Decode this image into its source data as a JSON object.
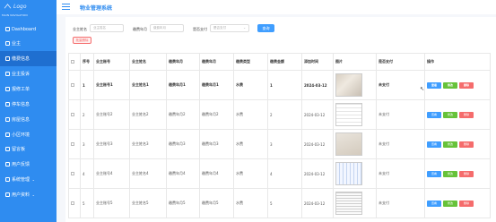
{
  "sidebar": {
    "logo_text": "Logo",
    "caption": "MAIN NAVIGATION",
    "items": [
      {
        "label": "Dashboard",
        "icon": "dashboard-icon"
      },
      {
        "label": "业主",
        "icon": "user-icon"
      },
      {
        "label": "缴费信息",
        "icon": "payment-icon",
        "active": true
      },
      {
        "label": "业主投诉",
        "icon": "complaint-icon"
      },
      {
        "label": "报修工单",
        "icon": "repair-icon"
      },
      {
        "label": "停车信息",
        "icon": "parking-icon"
      },
      {
        "label": "房屋信息",
        "icon": "house-icon"
      },
      {
        "label": "小区环境",
        "icon": "environment-icon"
      },
      {
        "label": "留言板",
        "icon": "message-icon"
      },
      {
        "label": "用户反馈",
        "icon": "feedback-icon"
      },
      {
        "label": "系统管理",
        "icon": "settings-icon",
        "expandable": true
      },
      {
        "label": "用户资料",
        "icon": "profile-icon",
        "expandable": true
      }
    ]
  },
  "header": {
    "title": "物业管理系统"
  },
  "filters": {
    "owner_name_label": "业主姓名",
    "owner_name_placeholder": "业主姓名",
    "fee_year_label": "缴费年月",
    "fee_year_placeholder": "缴费年月",
    "paid_label": "是否支付",
    "paid_placeholder": "是否支付",
    "search_button": "查询",
    "batch_delete_button": "批量删除"
  },
  "table": {
    "headers": [
      "",
      "序号",
      "业主账号",
      "业主姓名",
      "缴费年月",
      "缴费年月",
      "缴费类型",
      "缴费金额",
      "添加时间",
      "图片",
      "是否支付",
      "操作"
    ],
    "rows": [
      {
        "idx": "1",
        "account": "业主账号1",
        "name": "业主姓名1",
        "year": "缴费年月1",
        "month": "缴费年月1",
        "type": "水费",
        "amount": "1",
        "date": "2024-03-12",
        "paid": "未支付"
      },
      {
        "idx": "2",
        "account": "业主账号2",
        "name": "业主姓名2",
        "year": "缴费年月2",
        "month": "缴费年月2",
        "type": "水费",
        "amount": "2",
        "date": "2024-03-12",
        "paid": "未支付"
      },
      {
        "idx": "3",
        "account": "业主账号3",
        "name": "业主姓名3",
        "year": "缴费年月3",
        "month": "缴费年月3",
        "type": "水费",
        "amount": "3",
        "date": "2024-03-12",
        "paid": "未支付"
      },
      {
        "idx": "4",
        "account": "业主账号4",
        "name": "业主姓名4",
        "year": "缴费年月4",
        "month": "缴费年月4",
        "type": "水费",
        "amount": "4",
        "date": "2024-03-12",
        "paid": "未支付"
      },
      {
        "idx": "5",
        "account": "业主账号5",
        "name": "业主姓名5",
        "year": "缴费年月5",
        "month": "缴费年月5",
        "type": "水费",
        "amount": "5",
        "date": "2024-03-12",
        "paid": "未支付"
      }
    ],
    "actions": {
      "view": "查看",
      "edit": "修改",
      "delete": "删除"
    }
  },
  "colors": {
    "sidebar": "#2f8cf0",
    "primary": "#409eff",
    "success": "#67c23a",
    "danger": "#f56c6c"
  }
}
